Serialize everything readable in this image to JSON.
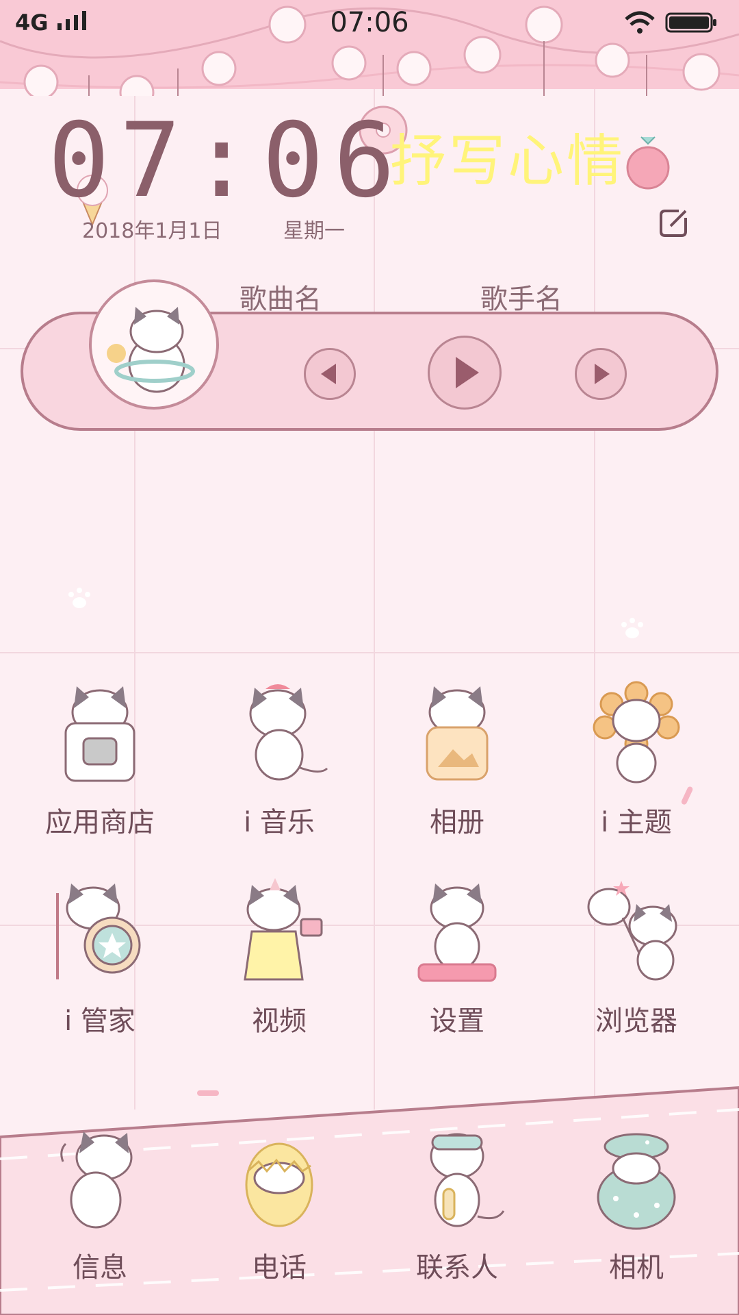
{
  "status_bar": {
    "network": "4G",
    "time": "07:06"
  },
  "widget": {
    "clock": "07:06",
    "mood_prompt": "抒写心情",
    "date": "2018年1月1日",
    "weekday": "星期一",
    "icons": {
      "edit": "edit-icon"
    }
  },
  "music": {
    "song_name": "歌曲名",
    "singer_name": "歌手名",
    "icons": {
      "prev": "previous-icon",
      "play": "play-icon",
      "next": "next-icon"
    }
  },
  "apps": [
    {
      "label": "应用商店",
      "icon": "app-store-icon"
    },
    {
      "label": "i 音乐",
      "icon": "music-icon"
    },
    {
      "label": "相册",
      "icon": "album-icon"
    },
    {
      "label": "i 主题",
      "icon": "theme-icon"
    },
    {
      "label": "i 管家",
      "icon": "manager-icon"
    },
    {
      "label": "视频",
      "icon": "video-icon"
    },
    {
      "label": "设置",
      "icon": "settings-icon"
    },
    {
      "label": "浏览器",
      "icon": "browser-icon"
    }
  ],
  "dock": [
    {
      "label": "信息",
      "icon": "messages-icon"
    },
    {
      "label": "电话",
      "icon": "phone-icon"
    },
    {
      "label": "联系人",
      "icon": "contacts-icon"
    },
    {
      "label": "相机",
      "icon": "camera-icon"
    }
  ],
  "colors": {
    "background": "#fdeff3",
    "accent": "#b77d8c",
    "mood_text": "#fff47a",
    "label_text": "#6f4d59"
  }
}
